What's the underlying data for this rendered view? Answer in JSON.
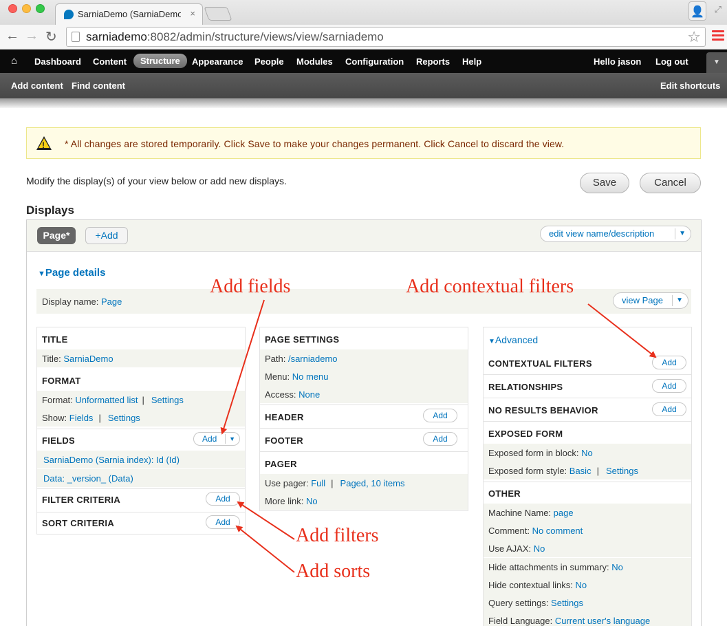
{
  "browser": {
    "tab_title": "SarniaDemo (SarniaDemo | ...",
    "tab_close": "×",
    "url_host": "sarniademo",
    "url_rest": ":8082/admin/structure/views/view/sarniademo",
    "icons": [
      "back-arrow-icon",
      "forward-arrow-icon",
      "reload-icon",
      "page-icon",
      "star-icon",
      "menu-icon",
      "profile-icon",
      "fullscreen-icon",
      "favicon-icon"
    ]
  },
  "toolbar": {
    "home": "⌂",
    "items": [
      "Dashboard",
      "Content",
      "Structure",
      "Appearance",
      "People",
      "Modules",
      "Configuration",
      "Reports",
      "Help"
    ],
    "active": "Structure",
    "hello_prefix": "Hello ",
    "user": "jason",
    "logout": "Log out"
  },
  "shortcuts": {
    "add_content": "Add content",
    "find_content": "Find content",
    "edit_shortcuts": "Edit shortcuts"
  },
  "warning": {
    "icon_glyph": "!",
    "text": "* All changes are stored temporarily. Click Save to make your changes permanent. Click Cancel to discard the view."
  },
  "intro": "Modify the display(s) of your view below or add new displays.",
  "buttons": {
    "save": "Save",
    "cancel": "Cancel"
  },
  "displays": {
    "title": "Displays",
    "tab_page": "Page*",
    "tab_add": "+Add",
    "edit_name": "edit view name/description",
    "page_details": "Page details",
    "display_name_label": "Display name: ",
    "display_name_value": "Page",
    "view_page": "view Page",
    "add_label": "Add"
  },
  "col1": {
    "title_h": "TITLE",
    "title_label": "Title: ",
    "title_value": "SarniaDemo",
    "format_h": "FORMAT",
    "format_label": "Format: ",
    "format_value": "Unformatted list",
    "format_settings": "Settings",
    "show_label": "Show: ",
    "show_value": "Fields",
    "show_settings": "Settings",
    "pipe": "|",
    "fields_h": "FIELDS",
    "field1": "SarniaDemo (Sarnia index): Id (Id)",
    "field2": "Data: _version_ (Data)",
    "filter_h": "FILTER CRITERIA",
    "sort_h": "SORT CRITERIA"
  },
  "col2": {
    "page_settings_h": "PAGE SETTINGS",
    "path_label": "Path: ",
    "path_value": "/sarniademo",
    "menu_label": "Menu: ",
    "menu_value": "No menu",
    "access_label": "Access: ",
    "access_value": "None",
    "header_h": "HEADER",
    "footer_h": "FOOTER",
    "pager_h": "PAGER",
    "use_pager_label": "Use pager: ",
    "use_pager_value": "Full",
    "use_pager_paged": "Paged, 10 items",
    "more_link_label": "More link: ",
    "more_link_value": "No"
  },
  "col3": {
    "advanced": "Advanced",
    "contextual_h": "CONTEXTUAL FILTERS",
    "relationships_h": "RELATIONSHIPS",
    "no_results_h": "NO RESULTS BEHAVIOR",
    "exposed_h": "EXPOSED FORM",
    "exposed_block_label": "Exposed form in block: ",
    "exposed_block_value": "No",
    "exposed_style_label": "Exposed form style: ",
    "exposed_style_value": "Basic",
    "exposed_style_settings": "Settings",
    "other_h": "OTHER",
    "machine_label": "Machine Name: ",
    "machine_value": "page",
    "comment_label": "Comment: ",
    "comment_value": "No comment",
    "ajax_label": "Use AJAX: ",
    "ajax_value": "No",
    "hide_attach_label": "Hide attachments in summary: ",
    "hide_attach_value": "No",
    "hide_ctx_label": "Hide contextual links: ",
    "hide_ctx_value": "No",
    "query_label": "Query settings: ",
    "query_value": "Settings",
    "field_lang_label": "Field Language: ",
    "field_lang_value": "Current user's language"
  },
  "annotations": {
    "add_fields": "Add fields",
    "add_contextual": "Add contextual filters",
    "add_filters": "Add filters",
    "add_sorts": "Add sorts",
    "color": "#e8301c"
  },
  "colors": {
    "link": "#0074bd",
    "toolbar": "#0b0b0b",
    "warning_bg": "#fffce5"
  }
}
